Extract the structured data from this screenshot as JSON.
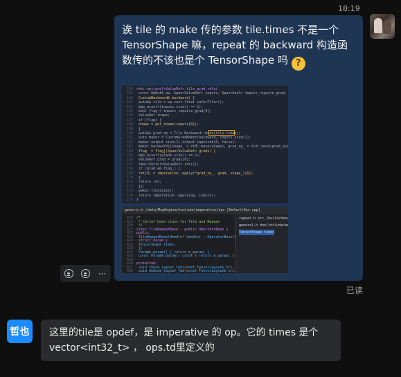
{
  "chat": {
    "timestamp": "18:19",
    "outgoing": {
      "text": "诶 tile 的 make 传的参数 tile.times 不是一个 TensorShape 嘛，repeat 的 backward 构造函数传的不该也是个 TensorShape 吗",
      "emoji": "thinking-face",
      "read_status": "已读",
      "attachments": [
        {
          "kind": "code-screenshot",
          "name": "tile-grad-code"
        },
        {
          "kind": "code-screenshot",
          "name": "ide-class-definition"
        }
      ]
    },
    "incoming": {
      "sender_name": "哲也",
      "text": "这里的tile是 opdef，是 imperative 的 op。它的 times 是个 vector<int32_t> ， ops.td里定义的"
    },
    "actions": [
      {
        "name": "add-reaction",
        "icon": "emoji-add-icon"
      },
      {
        "name": "reply",
        "icon": "reply-icon"
      },
      {
        "name": "more",
        "icon": "more-icon",
        "label": "···"
      }
    ]
  },
  "code_shot_1": {
    "lines": [
      {
        "n": "150",
        "text": "std::optional<ValueRef> tile_grad_rule("
      },
      {
        "n": "151",
        "text": "        const OpDef& op, Span<ValueRef> inputs, Span<bool> inputs_require_grad,"
      },
      {
        "n": "152",
        "text": "        CustomBackward& backward) {"
      },
      {
        "n": "153",
        "text": "    auto&& tile = op.cast_final_safe<Tile>();"
      },
      {
        "n": "154",
        "text": "    mgb_assert(inputs.size() == 1);"
      },
      {
        "n": "155",
        "text": "    bool flag = inputs_require_grad[0];"
      },
      {
        "n": "156",
        "text": "    ValueRef shape;"
      },
      {
        "n": "157",
        "text": "    if (flag) {"
      },
      {
        "n": "158",
        "text": "        shape = get_shape(inputs[0]);"
      },
      {
        "n": "159",
        "text": "    }"
      },
      {
        "n": "160",
        "text": "    auto&& grad_op = Tile Backward::make(tile.times);"
      },
      {
        "n": "161",
        "text": "    auto maker = CustomGradMaker(backward, inputs.size());"
      },
      {
        "n": "162",
        "text": "    maker.output_size(1).output_captured(0, false);"
      },
      {
        "n": "163",
        "text": "    maker.backward([shape_ = std::move(shape), grad_op_ = std::move(grad_op),"
      },
      {
        "n": "164",
        "text": "                    flag_ = flag](Span<ValueRef> grads) {"
      },
      {
        "n": "165",
        "text": "        mgb_assert(grads.size() == 1);"
      },
      {
        "n": "166",
        "text": "        ValueRef grad = grads[0];"
      },
      {
        "n": "167",
        "text": "        SmallVector<ValueRef> ret(1);"
      },
      {
        "n": "168",
        "text": "        if (grad && flag_) {"
      },
      {
        "n": "169",
        "text": "            ret[0] = imperative::apply(*grad_op_, grad, shape_)[0];"
      },
      {
        "n": "170",
        "text": "        }"
      },
      {
        "n": "171",
        "text": "        return ret;"
      },
      {
        "n": "172",
        "text": "    });"
      },
      {
        "n": "173",
        "text": "    maker.finalize();"
      },
      {
        "n": "174",
        "text": "    return imperative::apply(op, inputs);"
      },
      {
        "n": "175",
        "text": "}"
      }
    ]
  },
  "code_shot_2": {
    "tab": "generic.h  /data/MegEngine/include/imperative/ops  [DefaultOps.cpp]",
    "lines": [
      {
        "n": "418",
        "text": "/*"
      },
      {
        "n": "419",
        "text": " * \\brief base class for Tile and Repeat"
      },
      {
        "n": "420",
        "text": " */"
      },
      {
        "n": "421",
        "text": "class TileRepeatBase : public OperatorBase {"
      },
      {
        "n": "422",
        "text": "public:"
      },
      {
        "n": "423",
        "text": "    TileRepeatBase(Handle* handle) : OperatorBase(handle) {"
      },
      {
        "n": "424",
        "text": "    struct Param {"
      },
      {
        "n": "425",
        "text": "        TensorShape times;"
      },
      {
        "n": "426",
        "text": "    };"
      },
      {
        "n": "427",
        "text": "    Param& param() { return m_param; }"
      },
      {
        "n": "428",
        "text": "    const Param& param() const { return m_param; }"
      },
      {
        "n": "429",
        "text": ""
      },
      {
        "n": "430",
        "text": "protected:"
      },
      {
        "n": "431",
        "text": "    void check_layout_fwd(const TensorLayout& src, const Ten"
      },
      {
        "n": "432",
        "text": "    void deduce_layout_fwd(const TensorLayout& src, Tensor"
      }
    ],
    "side_items": [
      "repeat.h src  /build/dnn/include/...",
      "general.h  dnn/include/megdnn/...",
      "TensorShape times"
    ]
  }
}
